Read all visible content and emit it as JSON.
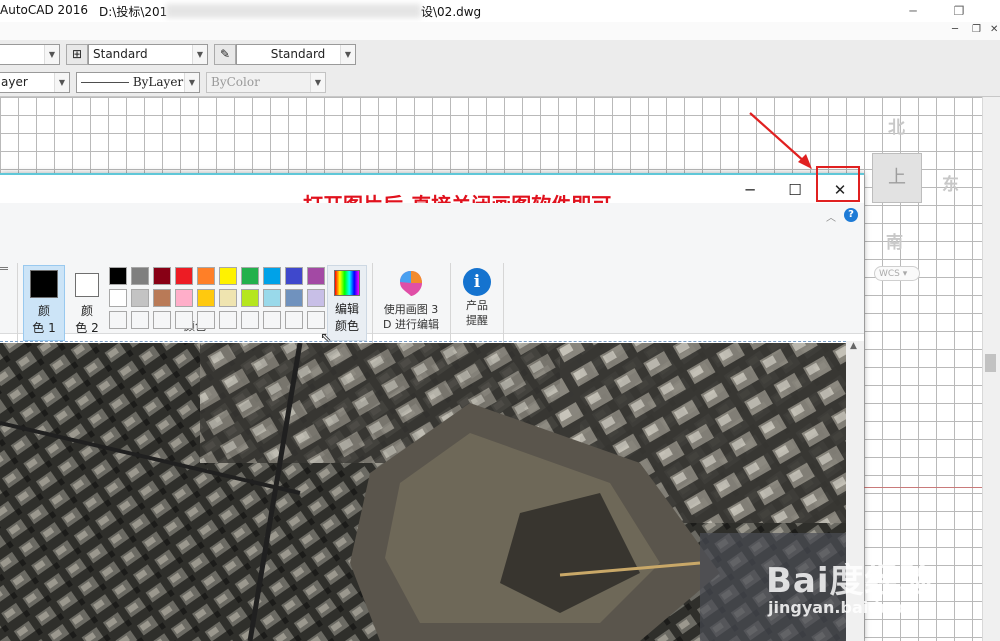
{
  "autocad": {
    "app_title": "AutoCAD 2016",
    "path_prefix": "D:\\投标\\201",
    "path_suffix": "设\\02.dwg",
    "style_combo_1": "Standard",
    "style_combo_2": "Standard",
    "layer_combo": "ayer",
    "linetype_combo": "ByLayer",
    "color_combo": "ByColor"
  },
  "viewcube": {
    "north": "北",
    "east": "东",
    "south": "南",
    "face": "上",
    "wcs": "WCS"
  },
  "annotation": "打开图片后-直接关闭画图软件即可",
  "paint": {
    "color1_label": "颜\n色 1",
    "color2_label": "颜\n色 2",
    "edit_colors_label": "编辑\n颜色",
    "paint3d_label": "使用画图 3\nD 进行编辑",
    "product_alert_label": "产品\n提醒",
    "colors_group_label": "颜色",
    "color1": "#000000",
    "color2": "#ffffff",
    "palette_row1": [
      "#000000",
      "#7f7f7f",
      "#880015",
      "#ed1c24",
      "#ff7f27",
      "#fff200",
      "#22b14c",
      "#00a2e8",
      "#3f48cc",
      "#a349a4"
    ],
    "palette_row2": [
      "#ffffff",
      "#c3c3c3",
      "#b97a57",
      "#ffaec9",
      "#ffc90e",
      "#efe4b0",
      "#b5e61d",
      "#99d9ea",
      "#7092be",
      "#c8bfe7"
    ]
  },
  "watermark": {
    "brand": "Bai度经验",
    "url": "jingyan.baidu.com"
  }
}
